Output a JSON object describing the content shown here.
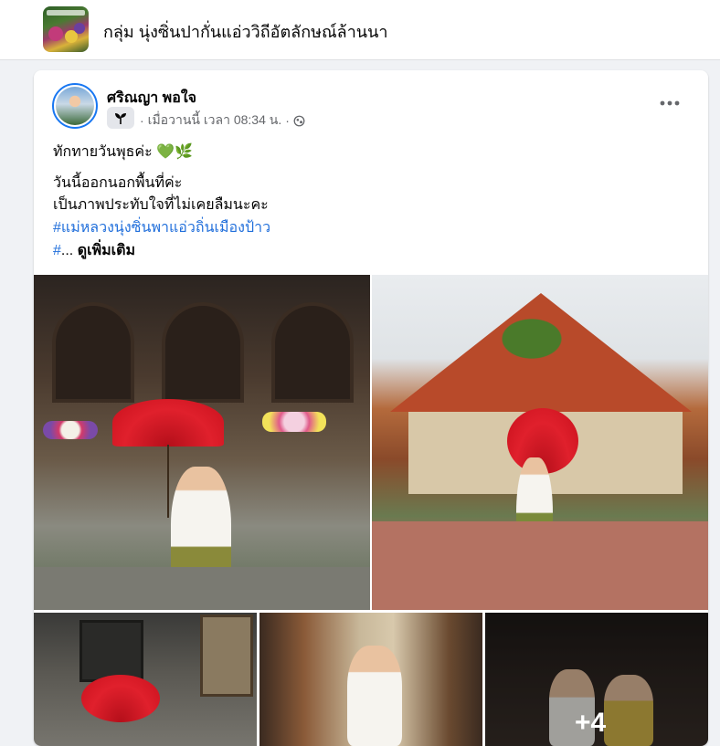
{
  "group": {
    "name": "กลุ่ม นุ่งซิ่นปากั่นแอ่ววิถีอัตลักษณ์ล้านนา"
  },
  "post": {
    "author": "ศริณญา พอใจ",
    "timestamp": "เมื่อวานนี้ เวลา 08:34 น.",
    "separator": "·",
    "lines": [
      "ทักทายวันพุธค่ะ 💚🌿",
      "วันนี้ออกนอกพื้นที่ค่ะ",
      "เป็นภาพประทับใจที่ไม่เคยลืมนะคะ",
      "#แม่หลวงนุ่งซิ่นพาแอ่วถิ่นเมืองป้าว"
    ],
    "last_hash": "#",
    "ellipsis": "...",
    "see_more": "ดูเพิ่มเติม",
    "more_photos": "+4"
  },
  "icons": {
    "badge": "new-member-sprout-icon",
    "audience": "globe-icon",
    "more": "more-options-icon"
  },
  "colors": {
    "link": "#216fdb",
    "meta": "#65676b",
    "avatar_ring": "#1877f2"
  }
}
